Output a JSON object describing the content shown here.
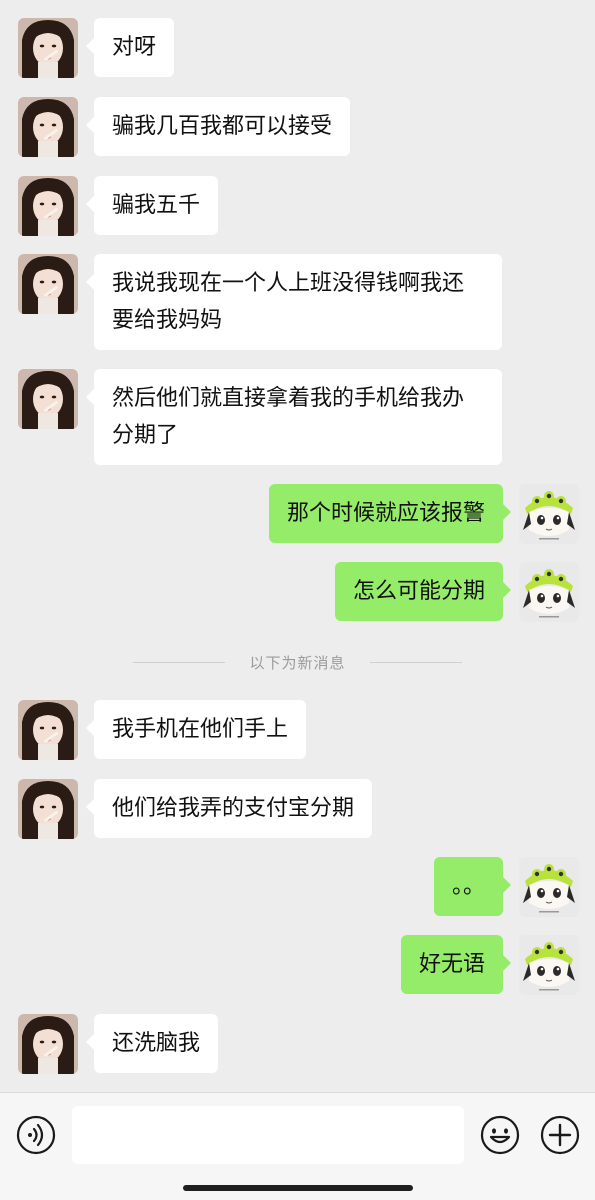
{
  "chat": {
    "messages": [
      {
        "side": "left",
        "text": "对呀"
      },
      {
        "side": "left",
        "text": "骗我几百我都可以接受"
      },
      {
        "side": "left",
        "text": "骗我五千"
      },
      {
        "side": "left",
        "text": "我说我现在一个人上班没得钱啊我还要给我妈妈"
      },
      {
        "side": "left",
        "text": "然后他们就直接拿着我的手机给我办分期了"
      },
      {
        "side": "right",
        "text": "那个时候就应该报警"
      },
      {
        "side": "right",
        "text": "怎么可能分期"
      },
      {
        "side": "left",
        "text": "我手机在他们手上"
      },
      {
        "side": "left",
        "text": "他们给我弄的支付宝分期"
      },
      {
        "side": "right",
        "text": "。。"
      },
      {
        "side": "right",
        "text": "好无语"
      },
      {
        "side": "left",
        "text": "还洗脑我"
      }
    ],
    "divider_label": "以下为新消息"
  },
  "inputbar": {
    "voice_icon": "voice-icon",
    "emoji_icon": "emoji-icon",
    "plus_icon": "plus-icon",
    "input_value": ""
  },
  "colors": {
    "background": "#ededed",
    "bubble_left": "#ffffff",
    "bubble_right": "#95ec69",
    "avatar_right_hat": "#b8e23c"
  }
}
